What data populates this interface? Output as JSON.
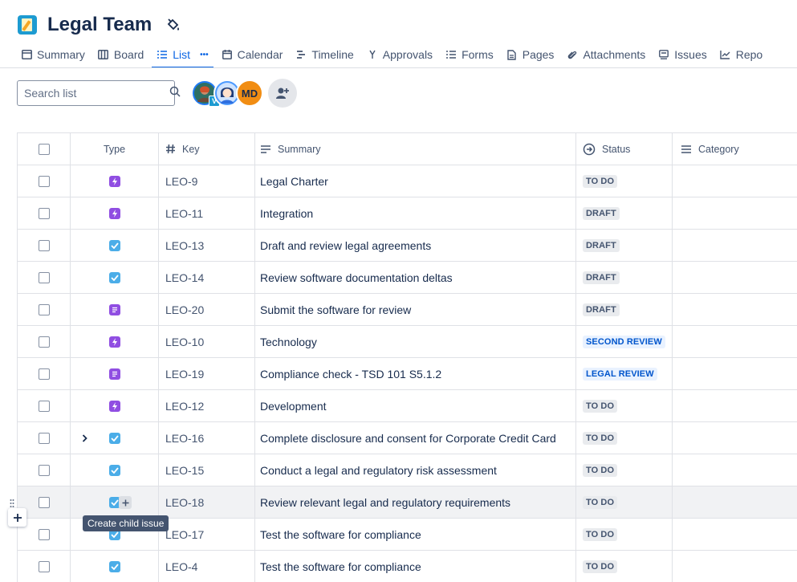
{
  "project": {
    "title": "Legal Team"
  },
  "tabs": [
    {
      "label": "Summary",
      "icon": "summary-icon"
    },
    {
      "label": "Board",
      "icon": "board-icon"
    },
    {
      "label": "List",
      "icon": "list-icon",
      "more": "•••"
    },
    {
      "label": "Calendar",
      "icon": "calendar-icon"
    },
    {
      "label": "Timeline",
      "icon": "timeline-icon"
    },
    {
      "label": "Approvals",
      "icon": "approvals-icon"
    },
    {
      "label": "Forms",
      "icon": "forms-icon"
    },
    {
      "label": "Pages",
      "icon": "pages-icon"
    },
    {
      "label": "Attachments",
      "icon": "attachment-icon"
    },
    {
      "label": "Issues",
      "icon": "issues-icon"
    },
    {
      "label": "Repo",
      "icon": "reports-icon"
    }
  ],
  "search": {
    "placeholder": "Search list",
    "value": ""
  },
  "avatars": [
    {
      "initials": "",
      "badge": "V"
    },
    {
      "initials": ""
    },
    {
      "initials": "MD"
    }
  ],
  "table": {
    "headers": {
      "type": "Type",
      "key": "Key",
      "summary": "Summary",
      "status": "Status",
      "category": "Category"
    },
    "rows": [
      {
        "type": "epic",
        "key": "LEO-9",
        "summary": "Legal Charter",
        "status": "TO DO",
        "status_style": "default"
      },
      {
        "type": "epic",
        "key": "LEO-11",
        "summary": "Integration",
        "status": "DRAFT",
        "status_style": "default"
      },
      {
        "type": "task",
        "key": "LEO-13",
        "summary": "Draft and review legal agreements",
        "status": "DRAFT",
        "status_style": "default"
      },
      {
        "type": "task",
        "key": "LEO-14",
        "summary": "Review software documentation deltas",
        "status": "DRAFT",
        "status_style": "default"
      },
      {
        "type": "story",
        "key": "LEO-20",
        "summary": "Submit the software for review",
        "status": "DRAFT",
        "status_style": "default"
      },
      {
        "type": "epic",
        "key": "LEO-10",
        "summary": "Technology",
        "status": "SECOND REVIEW",
        "status_style": "blue"
      },
      {
        "type": "story",
        "key": "LEO-19",
        "summary": "Compliance check - TSD 101 S5.1.2",
        "status": "LEGAL REVIEW",
        "status_style": "blue"
      },
      {
        "type": "epic",
        "key": "LEO-12",
        "summary": "Development",
        "status": "TO DO",
        "status_style": "default"
      },
      {
        "type": "task",
        "key": "LEO-16",
        "summary": "Complete disclosure and consent for Corporate Credit Card",
        "status": "TO DO",
        "status_style": "default",
        "expandable": true
      },
      {
        "type": "task",
        "key": "LEO-15",
        "summary": "Conduct a legal and regulatory risk assessment",
        "status": "TO DO",
        "status_style": "default"
      },
      {
        "type": "task",
        "key": "LEO-18",
        "summary": "Review relevant legal and regulatory requirements",
        "status": "TO DO",
        "status_style": "default",
        "hovered": true
      },
      {
        "type": "task",
        "key": "LEO-17",
        "summary": "Test the software for compliance",
        "status": "TO DO",
        "status_style": "default"
      },
      {
        "type": "task",
        "key": "LEO-4",
        "summary": "Test the software for compliance",
        "status": "TO DO",
        "status_style": "default"
      }
    ]
  },
  "tooltip": {
    "text": "Create child issue"
  },
  "colors": {
    "accent": "#0c66e4",
    "epic": "#904ee2",
    "task": "#4bade8"
  }
}
